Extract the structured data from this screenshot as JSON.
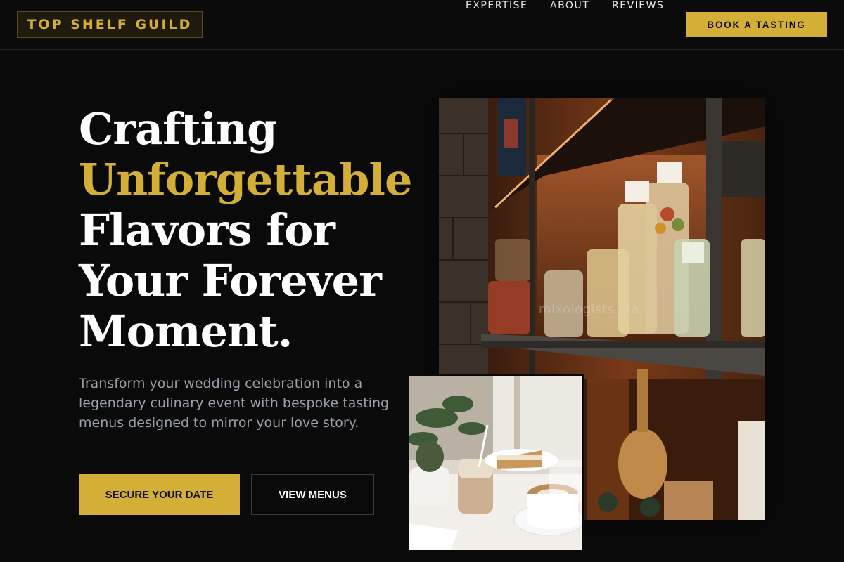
{
  "header": {
    "logo": "TOP SHELF GUILD",
    "nav": [
      "EXPERTISE",
      "ABOUT",
      "REVIEWS"
    ],
    "cta": "BOOK A TASTING"
  },
  "hero": {
    "headline_line1": "Crafting",
    "headline_line2": "Unforgettable",
    "headline_line3": "Flavors for",
    "headline_line4": "Your Forever",
    "headline_line5": "Moment.",
    "subtext": "Transform your wedding celebration into a legendary culinary event with bespoke tasting menus designed to mirror your love story.",
    "primary_button": "SECURE YOUR DATE",
    "secondary_button": "VIEW MENUS"
  },
  "images": {
    "watermark": "mixologists.ma"
  },
  "colors": {
    "accent": "#d4af37",
    "background": "#0a0a0a",
    "muted_text": "#9aa0ab"
  }
}
